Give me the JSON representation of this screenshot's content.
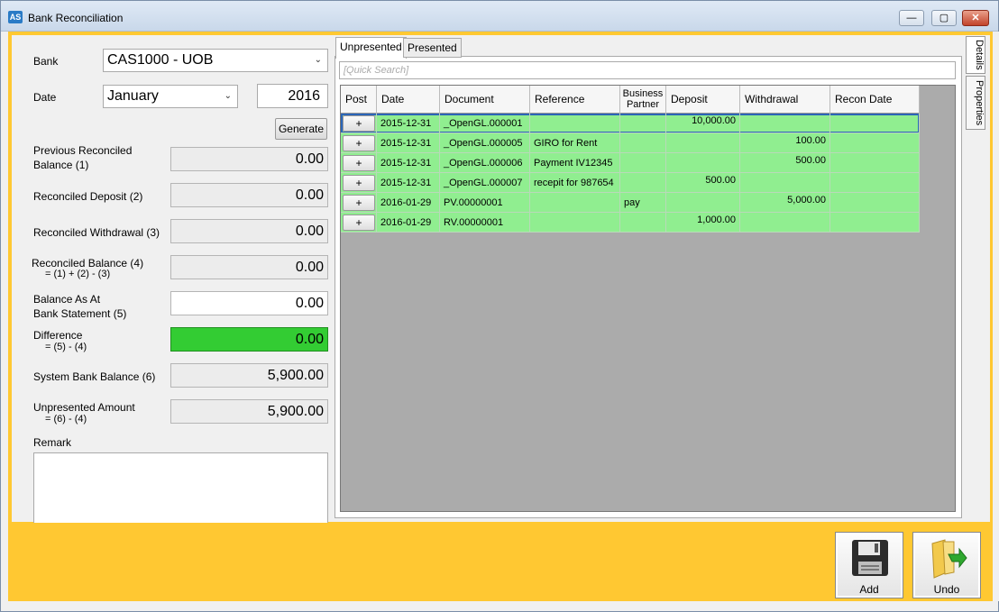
{
  "window": {
    "title": "Bank Reconciliation",
    "app_icon": "AS",
    "minimize": "—",
    "maximize": "▢",
    "close": "✕"
  },
  "form": {
    "bank_label": "Bank",
    "bank_value": "CAS1000 - UOB",
    "date_label": "Date",
    "month_value": "January",
    "year_value": "2016",
    "generate_label": "Generate",
    "fields": [
      {
        "label": "Previous Reconciled Balance (1)",
        "value": "0.00"
      },
      {
        "label": "Reconciled Deposit (2)",
        "value": "0.00"
      },
      {
        "label": "Reconciled Withdrawal (3)",
        "value": "0.00"
      },
      {
        "label": "Reconciled Balance (4)",
        "sub": "= (1) + (2) - (3)",
        "value": "0.00"
      },
      {
        "label": "Balance As At Bank Statement (5)",
        "value": "0.00"
      },
      {
        "label": "Difference",
        "sub": "= (5) - (4)",
        "value": "0.00"
      },
      {
        "label": "System Bank Balance (6)",
        "value": "5,900.00"
      },
      {
        "label": "Unpresented Amount",
        "sub": "= (6) - (4)",
        "value": "5,900.00"
      }
    ],
    "prev_label_1": "Previous Reconciled",
    "prev_label_2": "Balance (1)",
    "bank_stmt_label_1": "Balance As At",
    "bank_stmt_label_2": "Bank Statement (5)",
    "remark_label": "Remark"
  },
  "tabs": {
    "unpresented": "Unpresented",
    "presented": "Presented"
  },
  "search": {
    "placeholder": "[Quick Search]"
  },
  "grid": {
    "columns": [
      "Post",
      "Date",
      "Document",
      "Reference",
      "Business Partner",
      "Deposit",
      "Withdrawal",
      "Recon Date"
    ],
    "business_partner_1": "Business",
    "business_partner_2": "Partner",
    "post_button": "+",
    "rows": [
      {
        "date": "2015-12-31",
        "document": "_OpenGL.000001",
        "reference": "",
        "partner": "",
        "deposit": "10,000.00",
        "withdrawal": "",
        "recon": ""
      },
      {
        "date": "2015-12-31",
        "document": "_OpenGL.000005",
        "reference": "GIRO for Rent",
        "partner": "",
        "deposit": "",
        "withdrawal": "100.00",
        "recon": ""
      },
      {
        "date": "2015-12-31",
        "document": "_OpenGL.000006",
        "reference": "Payment IV12345",
        "partner": "",
        "deposit": "",
        "withdrawal": "500.00",
        "recon": ""
      },
      {
        "date": "2015-12-31",
        "document": "_OpenGL.000007",
        "reference": "recepit for 987654",
        "partner": "",
        "deposit": "500.00",
        "withdrawal": "",
        "recon": ""
      },
      {
        "date": "2016-01-29",
        "document": "PV.00000001",
        "reference": "",
        "partner": "pay",
        "deposit": "",
        "withdrawal": "5,000.00",
        "recon": ""
      },
      {
        "date": "2016-01-29",
        "document": "RV.00000001",
        "reference": "",
        "partner": "",
        "deposit": "1,000.00",
        "withdrawal": "",
        "recon": ""
      }
    ]
  },
  "side_tabs": {
    "details": "Details",
    "properties": "Properties"
  },
  "buttons": {
    "add": "Add",
    "undo": "Undo"
  },
  "colors": {
    "accent_yellow": "#ffc832",
    "row_green": "#90ee90",
    "difference_green": "#33cc33"
  }
}
